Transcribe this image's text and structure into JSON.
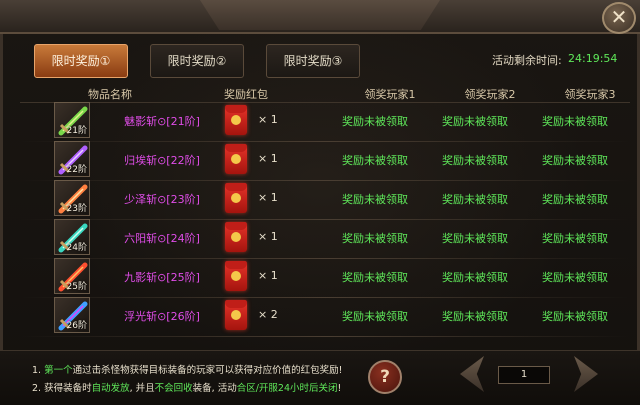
{
  "tabs": [
    {
      "label": "限时奖励①",
      "active": true
    },
    {
      "label": "限时奖励②",
      "active": false
    },
    {
      "label": "限时奖励③",
      "active": false
    }
  ],
  "countdown": {
    "label": "活动剩余时间:",
    "value": "24:19:54"
  },
  "headers": {
    "item_name": "物品名称",
    "reward": "奖励红包",
    "player1": "领奖玩家1",
    "player2": "领奖玩家2",
    "player3": "领奖玩家3"
  },
  "rows": [
    {
      "level": "21阶",
      "name": "魅影斩⊙[21阶]",
      "qty": "× 1",
      "p1": "奖励未被领取",
      "p2": "奖励未被领取",
      "p3": "奖励未被领取"
    },
    {
      "level": "22阶",
      "name": "归埃斩⊙[22阶]",
      "qty": "× 1",
      "p1": "奖励未被领取",
      "p2": "奖励未被领取",
      "p3": "奖励未被领取"
    },
    {
      "level": "23阶",
      "name": "少泽斩⊙[23阶]",
      "qty": "× 1",
      "p1": "奖励未被领取",
      "p2": "奖励未被领取",
      "p3": "奖励未被领取"
    },
    {
      "level": "24阶",
      "name": "六阳斩⊙[24阶]",
      "qty": "× 1",
      "p1": "奖励未被领取",
      "p2": "奖励未被领取",
      "p3": "奖励未被领取"
    },
    {
      "level": "25阶",
      "name": "九影斩⊙[25阶]",
      "qty": "× 1",
      "p1": "奖励未被领取",
      "p2": "奖励未被领取",
      "p3": "奖励未被领取"
    },
    {
      "level": "26阶",
      "name": "浮光斩⊙[26阶]",
      "qty": "× 2",
      "p1": "奖励未被领取",
      "p2": "奖励未被领取",
      "p3": "奖励未被领取"
    }
  ],
  "notes": {
    "n1_a": "1. ",
    "n1_hl": "第一个",
    "n1_b": "通过击杀怪物获得目标装备的玩家可以获得对应价值的红包奖励!",
    "n2_a": "2. 获得装备时",
    "n2_hl1": "自动发放",
    "n2_b": ", 并且",
    "n2_hl2": "不会回收",
    "n2_c": "装备, 活动",
    "n2_hl3": "合区/开服24小时后关闭",
    "n2_d": "!"
  },
  "help_label": "?",
  "close_label": "✕",
  "page": "1",
  "colors": {
    "accent_green": "#5fe85a",
    "item_purple": "#e04de8",
    "tab_active": "#c87a3a"
  }
}
